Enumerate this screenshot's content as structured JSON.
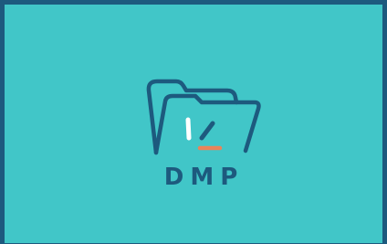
{
  "splash": {
    "logo": {
      "icon": "open-folder-check-icon",
      "wordmark": "DMP"
    }
  },
  "colors": {
    "background": "#41c6c8",
    "border": "#1d5a7e",
    "logo_navy": "#1d5a7e",
    "check_white": "#ffffff",
    "underline_orange": "#e9845a"
  }
}
